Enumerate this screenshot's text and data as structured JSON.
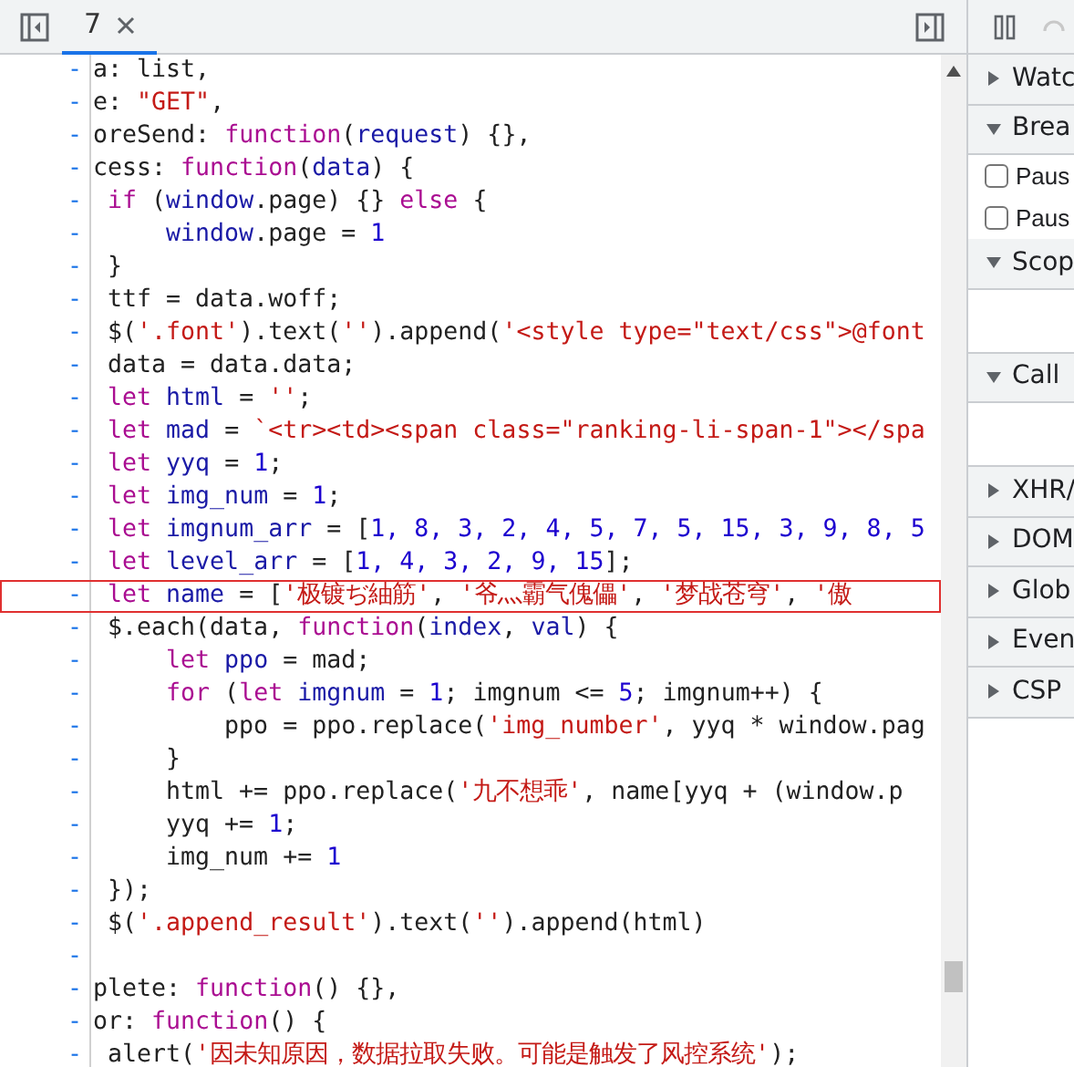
{
  "editor": {
    "tabs": [
      {
        "label": "7",
        "selected": true
      }
    ],
    "lines": [
      {
        "marker": "-",
        "highlighted": false,
        "tokens": [
          {
            "kind": "p",
            "text": "a: list,"
          }
        ]
      },
      {
        "marker": "-",
        "highlighted": false,
        "tokens": [
          {
            "kind": "p",
            "text": "e: "
          },
          {
            "kind": "s",
            "text": "\"GET\""
          },
          {
            "kind": "p",
            "text": ","
          }
        ]
      },
      {
        "marker": "-",
        "highlighted": false,
        "tokens": [
          {
            "kind": "p",
            "text": "oreSend: "
          },
          {
            "kind": "k",
            "text": "function"
          },
          {
            "kind": "p",
            "text": "("
          },
          {
            "kind": "v",
            "text": "request"
          },
          {
            "kind": "p",
            "text": ") {},"
          }
        ]
      },
      {
        "marker": "-",
        "highlighted": false,
        "tokens": [
          {
            "kind": "p",
            "text": "cess: "
          },
          {
            "kind": "k",
            "text": "function"
          },
          {
            "kind": "p",
            "text": "("
          },
          {
            "kind": "v",
            "text": "data"
          },
          {
            "kind": "p",
            "text": ") {"
          }
        ]
      },
      {
        "marker": "-",
        "highlighted": false,
        "tokens": [
          {
            "kind": "k",
            "text": " if"
          },
          {
            "kind": "p",
            "text": " ("
          },
          {
            "kind": "v",
            "text": "window"
          },
          {
            "kind": "p",
            "text": ".page) {} "
          },
          {
            "kind": "k",
            "text": "else"
          },
          {
            "kind": "p",
            "text": " {"
          }
        ]
      },
      {
        "marker": "-",
        "highlighted": false,
        "tokens": [
          {
            "kind": "v",
            "text": "     window"
          },
          {
            "kind": "p",
            "text": ".page = "
          },
          {
            "kind": "n",
            "text": "1"
          }
        ]
      },
      {
        "marker": "-",
        "highlighted": false,
        "tokens": [
          {
            "kind": "p",
            "text": " }"
          }
        ]
      },
      {
        "marker": "-",
        "highlighted": false,
        "tokens": [
          {
            "kind": "p",
            "text": " ttf = data.woff;"
          }
        ]
      },
      {
        "marker": "-",
        "highlighted": false,
        "tokens": [
          {
            "kind": "p",
            "text": " $("
          },
          {
            "kind": "s",
            "text": "'.font'"
          },
          {
            "kind": "p",
            "text": ").text("
          },
          {
            "kind": "s",
            "text": "''"
          },
          {
            "kind": "p",
            "text": ").append("
          },
          {
            "kind": "s",
            "text": "'<style type=\"text/css\">@font"
          }
        ]
      },
      {
        "marker": "-",
        "highlighted": false,
        "tokens": [
          {
            "kind": "p",
            "text": " data = data.data;"
          }
        ]
      },
      {
        "marker": "-",
        "highlighted": false,
        "tokens": [
          {
            "kind": "k",
            "text": " let"
          },
          {
            "kind": "v",
            "text": " html"
          },
          {
            "kind": "p",
            "text": " = "
          },
          {
            "kind": "s",
            "text": "''"
          },
          {
            "kind": "p",
            "text": ";"
          }
        ]
      },
      {
        "marker": "-",
        "highlighted": false,
        "tokens": [
          {
            "kind": "k",
            "text": " let"
          },
          {
            "kind": "v",
            "text": " mad"
          },
          {
            "kind": "p",
            "text": " = "
          },
          {
            "kind": "s",
            "text": "`<tr><td><span class=\"ranking-li-span-1\"></spa"
          }
        ]
      },
      {
        "marker": "-",
        "highlighted": false,
        "tokens": [
          {
            "kind": "k",
            "text": " let"
          },
          {
            "kind": "v",
            "text": " yyq"
          },
          {
            "kind": "p",
            "text": " = "
          },
          {
            "kind": "n",
            "text": "1"
          },
          {
            "kind": "p",
            "text": ";"
          }
        ]
      },
      {
        "marker": "-",
        "highlighted": false,
        "tokens": [
          {
            "kind": "k",
            "text": " let"
          },
          {
            "kind": "v",
            "text": " img_num"
          },
          {
            "kind": "p",
            "text": " = "
          },
          {
            "kind": "n",
            "text": "1"
          },
          {
            "kind": "p",
            "text": ";"
          }
        ]
      },
      {
        "marker": "-",
        "highlighted": false,
        "tokens": [
          {
            "kind": "k",
            "text": " let"
          },
          {
            "kind": "v",
            "text": " imgnum_arr"
          },
          {
            "kind": "p",
            "text": " = ["
          },
          {
            "kind": "n",
            "text": "1, 8, 3, 2, 4, 5, 7, 5, 15, 3, 9, 8, 5"
          }
        ]
      },
      {
        "marker": "-",
        "highlighted": false,
        "tokens": [
          {
            "kind": "k",
            "text": " let"
          },
          {
            "kind": "v",
            "text": " level_arr"
          },
          {
            "kind": "p",
            "text": " = ["
          },
          {
            "kind": "n",
            "text": "1, 4, 3, 2, 9, 15"
          },
          {
            "kind": "p",
            "text": "];"
          }
        ]
      },
      {
        "marker": "-",
        "highlighted": true,
        "tokens": [
          {
            "kind": "k",
            "text": " let"
          },
          {
            "kind": "v",
            "text": " name"
          },
          {
            "kind": "p",
            "text": " = ["
          },
          {
            "kind": "s",
            "text": "'极镀ぢ紬筋'"
          },
          {
            "kind": "p",
            "text": ", "
          },
          {
            "kind": "s",
            "text": "'爷灬霸气傀儡'"
          },
          {
            "kind": "p",
            "text": ", "
          },
          {
            "kind": "s",
            "text": "'梦战苍穹'"
          },
          {
            "kind": "p",
            "text": ", "
          },
          {
            "kind": "s",
            "text": "'傲"
          }
        ]
      },
      {
        "marker": "-",
        "highlighted": false,
        "tokens": [
          {
            "kind": "p",
            "text": " $.each(data, "
          },
          {
            "kind": "k",
            "text": "function"
          },
          {
            "kind": "p",
            "text": "("
          },
          {
            "kind": "v",
            "text": "index"
          },
          {
            "kind": "p",
            "text": ", "
          },
          {
            "kind": "v",
            "text": "val"
          },
          {
            "kind": "p",
            "text": ") {"
          }
        ]
      },
      {
        "marker": "-",
        "highlighted": false,
        "tokens": [
          {
            "kind": "k",
            "text": "     let"
          },
          {
            "kind": "v",
            "text": " ppo"
          },
          {
            "kind": "p",
            "text": " = mad;"
          }
        ]
      },
      {
        "marker": "-",
        "highlighted": false,
        "tokens": [
          {
            "kind": "k",
            "text": "     for"
          },
          {
            "kind": "p",
            "text": " ("
          },
          {
            "kind": "k",
            "text": "let"
          },
          {
            "kind": "v",
            "text": " imgnum"
          },
          {
            "kind": "p",
            "text": " = "
          },
          {
            "kind": "n",
            "text": "1"
          },
          {
            "kind": "p",
            "text": "; imgnum <= "
          },
          {
            "kind": "n",
            "text": "5"
          },
          {
            "kind": "p",
            "text": "; imgnum++) {"
          }
        ]
      },
      {
        "marker": "-",
        "highlighted": false,
        "tokens": [
          {
            "kind": "p",
            "text": "         ppo = ppo.replace("
          },
          {
            "kind": "s",
            "text": "'img_number'"
          },
          {
            "kind": "p",
            "text": ", yyq * window.pag"
          }
        ]
      },
      {
        "marker": "-",
        "highlighted": false,
        "tokens": [
          {
            "kind": "p",
            "text": "     }"
          }
        ]
      },
      {
        "marker": "-",
        "highlighted": false,
        "tokens": [
          {
            "kind": "p",
            "text": "     html += ppo.replace("
          },
          {
            "kind": "s",
            "text": "'九不想乖'"
          },
          {
            "kind": "p",
            "text": ", name[yyq + (window.p"
          }
        ]
      },
      {
        "marker": "-",
        "highlighted": false,
        "tokens": [
          {
            "kind": "p",
            "text": "     yyq += "
          },
          {
            "kind": "n",
            "text": "1"
          },
          {
            "kind": "p",
            "text": ";"
          }
        ]
      },
      {
        "marker": "-",
        "highlighted": false,
        "tokens": [
          {
            "kind": "p",
            "text": "     img_num += "
          },
          {
            "kind": "n",
            "text": "1"
          }
        ]
      },
      {
        "marker": "-",
        "highlighted": false,
        "tokens": [
          {
            "kind": "p",
            "text": " });"
          }
        ]
      },
      {
        "marker": "-",
        "highlighted": false,
        "tokens": [
          {
            "kind": "p",
            "text": " $("
          },
          {
            "kind": "s",
            "text": "'.append_result'"
          },
          {
            "kind": "p",
            "text": ").text("
          },
          {
            "kind": "s",
            "text": "''"
          },
          {
            "kind": "p",
            "text": ").append(html)"
          }
        ]
      },
      {
        "marker": "-",
        "highlighted": false
      },
      {
        "marker": "-",
        "highlighted": false,
        "tokens": [
          {
            "kind": "p",
            "text": "plete: "
          },
          {
            "kind": "k",
            "text": "function"
          },
          {
            "kind": "p",
            "text": "() {},"
          }
        ]
      },
      {
        "marker": "-",
        "highlighted": false,
        "tokens": [
          {
            "kind": "p",
            "text": "or: "
          },
          {
            "kind": "k",
            "text": "function"
          },
          {
            "kind": "p",
            "text": "() {"
          }
        ]
      },
      {
        "marker": "-",
        "highlighted": false,
        "tokens": [
          {
            "kind": "p",
            "text": " alert("
          },
          {
            "kind": "s",
            "text": "'因未知原因，数据拉取失败。可能是触发了风控系统'"
          },
          {
            "kind": "p",
            "text": ");"
          }
        ]
      }
    ]
  },
  "debugger": {
    "sections": [
      {
        "kind": "header",
        "label": "Watc",
        "expanded": false
      },
      {
        "kind": "header",
        "label": "Brea",
        "expanded": true
      },
      {
        "kind": "checkbox",
        "label": "Paus",
        "checked": false
      },
      {
        "kind": "checkbox",
        "label": "Paus",
        "checked": false
      },
      {
        "kind": "header",
        "label": "Scop",
        "expanded": true
      },
      {
        "kind": "blank"
      },
      {
        "kind": "header",
        "label": "Call",
        "expanded": true
      },
      {
        "kind": "blank"
      },
      {
        "kind": "header",
        "label": "XHR/",
        "expanded": false
      },
      {
        "kind": "header",
        "label": "DOM",
        "expanded": false
      },
      {
        "kind": "header",
        "label": "Glob",
        "expanded": false
      },
      {
        "kind": "header",
        "label": "Even",
        "expanded": false
      },
      {
        "kind": "header",
        "label": "CSP",
        "expanded": false
      }
    ]
  }
}
